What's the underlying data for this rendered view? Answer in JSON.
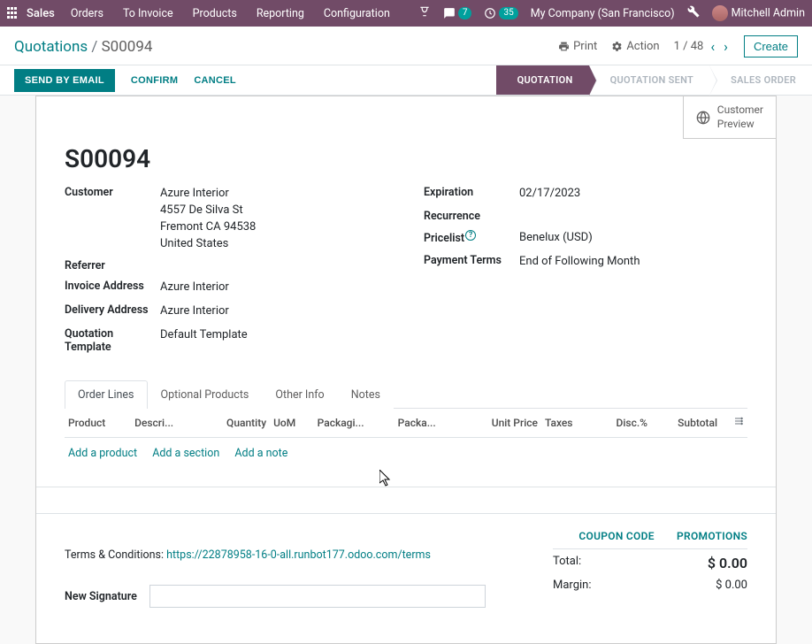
{
  "topnav": {
    "brand": "Sales",
    "menu": [
      "Orders",
      "To Invoice",
      "Products",
      "Reporting",
      "Configuration"
    ],
    "chat_badge": "7",
    "clock_badge": "35",
    "company": "My Company (San Francisco)",
    "user": "Mitchell Admin"
  },
  "breadcrumb": {
    "parent": "Quotations",
    "current": "S00094"
  },
  "cp": {
    "print": "Print",
    "action": "Action",
    "pager": "1 / 48",
    "create": "Create"
  },
  "actions": {
    "send": "SEND BY EMAIL",
    "confirm": "CONFIRM",
    "cancel": "CANCEL"
  },
  "steps": [
    "QUOTATION",
    "QUOTATION SENT",
    "SALES ORDER"
  ],
  "preview": {
    "l1": "Customer",
    "l2": "Preview"
  },
  "order": {
    "name": "S00094",
    "labels": {
      "customer": "Customer",
      "referrer": "Referrer",
      "invoice_addr": "Invoice Address",
      "delivery_addr": "Delivery Address",
      "template": "Quotation Template",
      "expiration": "Expiration",
      "recurrence": "Recurrence",
      "pricelist": "Pricelist",
      "payment_terms": "Payment Terms"
    },
    "customer": {
      "name": "Azure Interior",
      "street": "4557 De Silva St",
      "city": "Fremont CA 94538",
      "country": "United States"
    },
    "referrer": "",
    "invoice_addr": "Azure Interior",
    "delivery_addr": "Azure Interior",
    "template": "Default Template",
    "expiration": "02/17/2023",
    "recurrence": "",
    "pricelist": "Benelux (USD)",
    "payment_terms": "End of Following Month"
  },
  "tabs": [
    "Order Lines",
    "Optional Products",
    "Other Info",
    "Notes"
  ],
  "ol_headers": [
    "Product",
    "Descri...",
    "Quantity",
    "UoM",
    "Packagi...",
    "Packa...",
    "Unit Price",
    "Taxes",
    "Disc.%",
    "Subtotal"
  ],
  "ol_add": {
    "product": "Add a product",
    "section": "Add a section",
    "note": "Add a note"
  },
  "footer": {
    "coupon": "COUPON CODE",
    "promo": "PROMOTIONS",
    "terms_label": "Terms & Conditions: ",
    "terms_link": "https://22878958-16-0-all.runbot177.odoo.com/terms",
    "total_label": "Total:",
    "total_value": "$ 0.00",
    "margin_label": "Margin:",
    "margin_value": "$ 0.00",
    "sig_label": "New Signature",
    "sig_value": ""
  }
}
